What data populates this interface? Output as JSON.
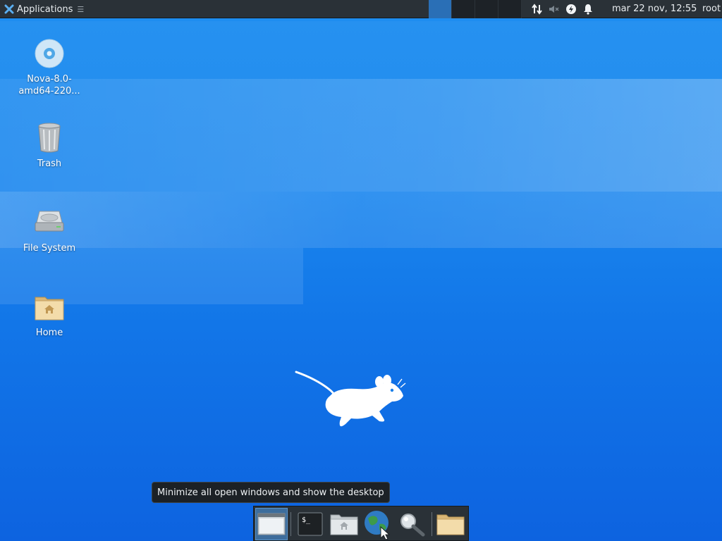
{
  "top_panel": {
    "applications_label": "Applications",
    "menu_indicator": "☰",
    "clock": "mar 22 nov, 12:55",
    "user": "root",
    "workspaces": [
      "1",
      "2",
      "3",
      "4"
    ],
    "active_workspace_index": 0,
    "tray_icons": [
      "network-updown-icon",
      "audio-muted-icon",
      "power-manager-icon",
      "notification-bell-icon"
    ]
  },
  "desktop_icons": [
    {
      "name": "disc-icon",
      "label": "Nova-8.0-amd64-220..."
    },
    {
      "name": "trash-icon",
      "label": "Trash"
    },
    {
      "name": "filesystem-icon",
      "label": "File System"
    },
    {
      "name": "home-folder-icon",
      "label": "Home"
    }
  ],
  "tooltip": {
    "text": "Minimize all open windows and show the desktop"
  },
  "dock": {
    "items": [
      "show-desktop-icon",
      "terminal-icon",
      "file-manager-icon",
      "web-browser-icon",
      "app-finder-icon",
      "folder-icon"
    ]
  },
  "colors": {
    "panel_bg": "#2a3137",
    "active_workspace": "#2a6fb6",
    "wallpaper_top": "#1e8ef0",
    "wallpaper_bottom": "#0d63e0"
  }
}
